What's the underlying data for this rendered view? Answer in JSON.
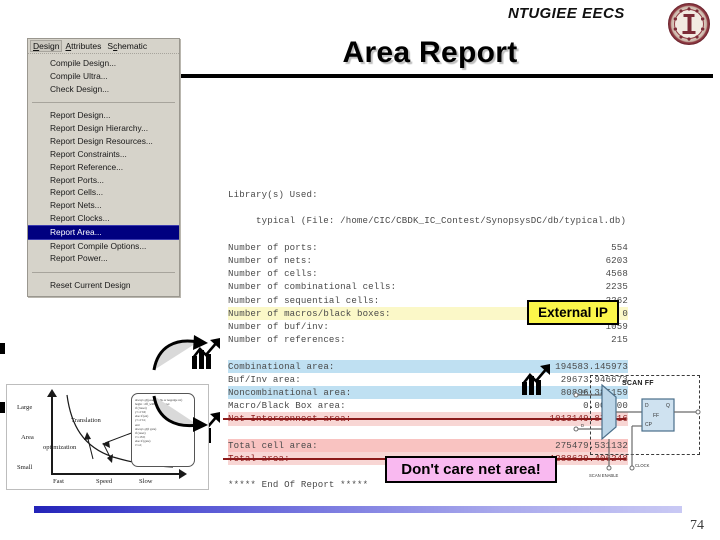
{
  "header": {
    "brand_bold": "NTU",
    "brand_rest": "GIEE EECS",
    "logo_name": "ntu-seal-logo"
  },
  "title": "Area Report",
  "menu": {
    "menubar": [
      {
        "label": "Design",
        "accel": "D",
        "selected": true
      },
      {
        "label": "Attributes",
        "accel": "A",
        "selected": false
      },
      {
        "label": "Schematic",
        "accel": "c",
        "selected": false
      }
    ],
    "groups": [
      {
        "items": [
          {
            "label": "Compile Design...",
            "active": false
          },
          {
            "label": "Compile Ultra...",
            "active": false
          },
          {
            "label": "Check Design...",
            "active": false
          }
        ]
      },
      {
        "items": [
          {
            "label": "Report Design...",
            "active": false
          },
          {
            "label": "Report Design Hierarchy...",
            "active": false
          },
          {
            "label": "Report Design Resources...",
            "active": false
          },
          {
            "label": "Report Constraints...",
            "active": false
          },
          {
            "label": "Report Reference...",
            "active": false
          },
          {
            "label": "Report Ports...",
            "active": false
          },
          {
            "label": "Report Cells...",
            "active": false
          },
          {
            "label": "Report Nets...",
            "active": false
          },
          {
            "label": "Report Clocks...",
            "active": false
          },
          {
            "label": "Report Area...",
            "active": true
          },
          {
            "label": "Report Compile Options...",
            "active": false
          },
          {
            "label": "Report Power...",
            "active": false
          }
        ]
      },
      {
        "items": [
          {
            "label": "Reset Current Design",
            "active": false
          }
        ]
      }
    ]
  },
  "report": {
    "library_header": "Library(s) Used:",
    "library_entry": "typical (File: /home/CIC/CBDK_IC_Contest/SynopsysDC/db/typical.db)",
    "counts": [
      {
        "label": "Number of ports:",
        "value": "554",
        "highlight": "none"
      },
      {
        "label": "Number of nets:",
        "value": "6203",
        "highlight": "none"
      },
      {
        "label": "Number of cells:",
        "value": "4568",
        "highlight": "none"
      },
      {
        "label": "Number of combinational cells:",
        "value": "2235",
        "highlight": "none"
      },
      {
        "label": "Number of sequential cells:",
        "value": "2262",
        "highlight": "none"
      },
      {
        "label": "Number of macros/black boxes:",
        "value": "0",
        "highlight": "yellow"
      },
      {
        "label": "Number of buf/inv:",
        "value": "1059",
        "highlight": "none"
      },
      {
        "label": "Number of references:",
        "value": "215",
        "highlight": "none"
      }
    ],
    "areas": [
      {
        "label": "Combinational area:",
        "value": "194583.145973",
        "highlight": "blue",
        "struck": false
      },
      {
        "label": "Buf/Inv area:",
        "value": "29673.946673",
        "highlight": "none",
        "struck": false
      },
      {
        "label": "Noncombinational area:",
        "value": "80896.385159",
        "highlight": "blue",
        "struck": false
      },
      {
        "label": "Macro/Black Box area:",
        "value": "0.000000",
        "highlight": "none",
        "struck": false
      },
      {
        "label": "Net Interconnect area:",
        "value": "1013149.875116",
        "highlight": "pinkfaint",
        "struck": true
      }
    ],
    "totals": [
      {
        "label": "Total cell area:",
        "value": "275479.531132",
        "highlight": "pink",
        "struck": false
      },
      {
        "label": "Total area:",
        "value": "1288629.406248",
        "highlight": "pinkfaint",
        "struck": true
      }
    ],
    "end_of_report": "***** End Of Report *****"
  },
  "callouts": {
    "external_ip": "External IP",
    "dont_care_net_area": "Don't care net area!"
  },
  "figure": {
    "y_labels": [
      "Large",
      "Area",
      "Small"
    ],
    "x_labels": [
      "Fast",
      "Speed",
      "Slow"
    ],
    "annotations": [
      "Translation",
      "optimization"
    ],
    "code_lines": [
      "always @(posedge clk or negedge rst)",
      "begin : dff_with_asyn_reset",
      "if (!reset)",
      "  y<=1'b0;",
      "else if (en)",
      "  y<=1'b1;",
      "end",
      "",
      "always @(I gate)",
      "if (reset)",
      "  t<=1'b0;",
      "else if (gate)",
      "  t<=d;"
    ]
  },
  "scanff": {
    "title": "SCAN FF",
    "pin_sd": "SD",
    "pin_d": "D",
    "pin_q": "Q",
    "ff_label": "FF",
    "ff_d": "D",
    "ff_q": "Q",
    "ff_cp": "CP",
    "scan_enable": "SCAN ENABLE",
    "clock": "CLOCK"
  },
  "footer": {
    "page_number": "74"
  },
  "colors": {
    "highlight_yellow": "#fbf8c8",
    "highlight_blue": "#bfe0f2",
    "highlight_pink": "#f9c3c1",
    "callout_yellow": "#fbf64a",
    "callout_pink": "#f9b9f0",
    "menu_active": "#000080",
    "strike_red": "#8c1b1b"
  }
}
